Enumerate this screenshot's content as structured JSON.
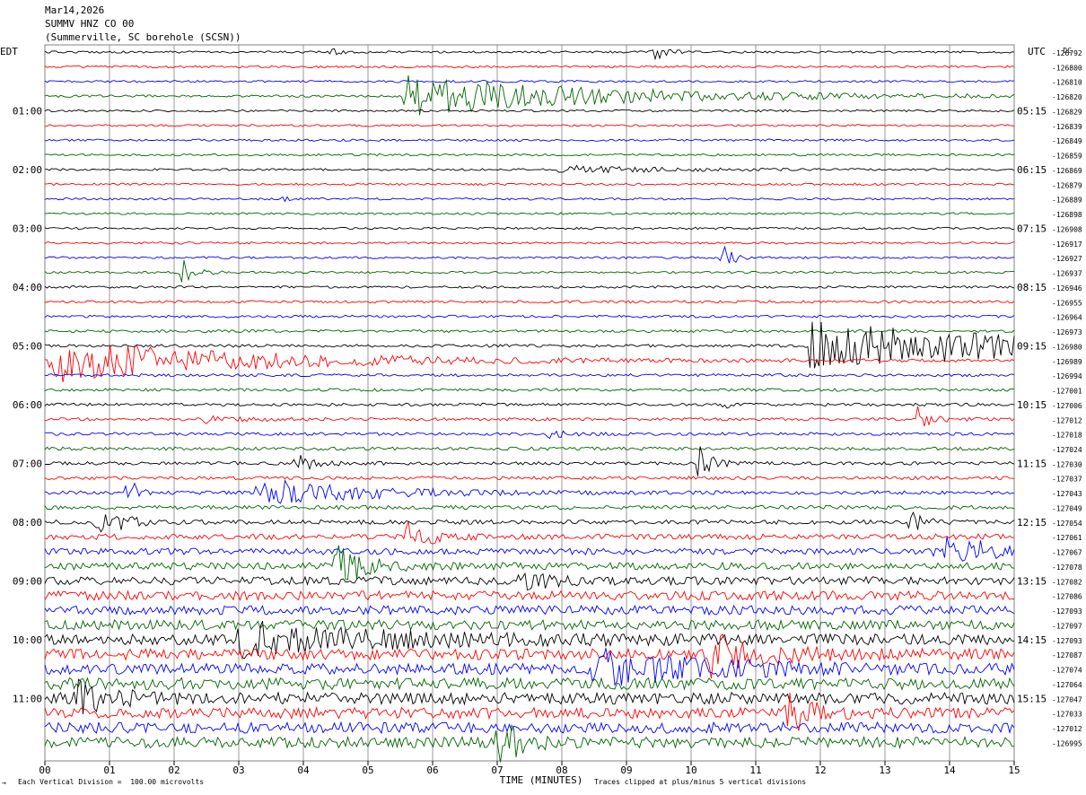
{
  "header": {
    "date": "Mar14,2026",
    "station": "SUMMV HNZ CO 00",
    "location": "(Summerville, SC borehole (SCSN))"
  },
  "labels": {
    "left_tz": "EDT",
    "right_tz": "UTC",
    "dc": "DC",
    "xlabel": "TIME (MINUTES)",
    "scale_note": "Each Vertical Division =  100.00 microvolts",
    "clip_note": "Traces clipped at plus/minus 5 vertical divisions",
    "corner_mark": "→"
  },
  "colors": {
    "trace_cycle": [
      "#000000",
      "#ff0000",
      "#0000ff",
      "#006400"
    ],
    "grid": "#808080",
    "background": "#ffffff"
  },
  "chart_data": {
    "type": "line",
    "title": "SUMMV HNZ CO 00",
    "xlabel": "TIME (MINUTES)",
    "xlim": [
      0,
      15
    ],
    "x_ticks": [
      "00",
      "01",
      "02",
      "03",
      "04",
      "05",
      "06",
      "07",
      "08",
      "09",
      "10",
      "11",
      "12",
      "13",
      "14",
      "15"
    ],
    "rows_per_hour": 4,
    "row_minutes": 15,
    "trace_count": 48,
    "left_hour_labels": [
      "EDT",
      "01:00",
      "02:00",
      "03:00",
      "04:00",
      "05:00",
      "06:00",
      "07:00",
      "08:00",
      "09:00",
      "10:00",
      "11:00"
    ],
    "right_hour_labels": [
      "UTC",
      "05:15",
      "06:15",
      "07:15",
      "08:15",
      "09:15",
      "10:15",
      "11:15",
      "12:15",
      "13:15",
      "14:15",
      "15:15"
    ],
    "dc_offsets": [
      -126792,
      -126800,
      -126810,
      -126820,
      -126829,
      -126839,
      -126849,
      -126859,
      -126869,
      -126879,
      -126889,
      -126898,
      -126908,
      -126917,
      -126927,
      -126937,
      -126946,
      -126955,
      -126964,
      -126973,
      -126980,
      -126989,
      -126994,
      -127001,
      -127006,
      -127012,
      -127018,
      -127024,
      -127030,
      -127037,
      -127043,
      -127049,
      -127054,
      -127061,
      -127067,
      -127078,
      -127082,
      -127086,
      -127093,
      -127097,
      -127093,
      -127087,
      -127074,
      -127064,
      -127047,
      -127033,
      -127012,
      -126995
    ],
    "noise_level": [
      1.2,
      1.3,
      1.2,
      1.3,
      1.2,
      1.2,
      1.2,
      1.2,
      1.2,
      1.2,
      1.2,
      1.2,
      1.2,
      1.2,
      1.2,
      1.2,
      1.3,
      1.4,
      1.4,
      1.5,
      1.6,
      1.5,
      1.6,
      1.6,
      1.6,
      1.7,
      1.7,
      1.8,
      1.8,
      1.9,
      2.0,
      2.2,
      2.4,
      3.0,
      3.5,
      4.0,
      4.5,
      5.0,
      5.0,
      5.5,
      6.0,
      6.0,
      6.0,
      6.5,
      6.5,
      6.0,
      6.0,
      6.0
    ],
    "events": [
      {
        "trace": 0,
        "minute": 9.4,
        "duration": 0.15,
        "amplitude": 20
      },
      {
        "trace": 0,
        "minute": 4.4,
        "duration": 0.2,
        "amplitude": 4
      },
      {
        "trace": 3,
        "minute": 5.6,
        "duration": 3.0,
        "amplitude": 22
      },
      {
        "trace": 8,
        "minute": 8.0,
        "duration": 1.2,
        "amplitude": 5
      },
      {
        "trace": 10,
        "minute": 3.7,
        "duration": 0.1,
        "amplitude": 4
      },
      {
        "trace": 14,
        "minute": 10.5,
        "duration": 0.15,
        "amplitude": 15
      },
      {
        "trace": 15,
        "minute": 2.1,
        "duration": 0.2,
        "amplitude": 16
      },
      {
        "trace": 20,
        "minute": 11.8,
        "duration": 3.5,
        "amplitude": 30
      },
      {
        "trace": 21,
        "minute": 0.1,
        "duration": 3.0,
        "amplitude": 24
      },
      {
        "trace": 24,
        "minute": 10.5,
        "duration": 0.15,
        "amplitude": 5
      },
      {
        "trace": 25,
        "minute": 13.5,
        "duration": 0.2,
        "amplitude": 14
      },
      {
        "trace": 25,
        "minute": 2.5,
        "duration": 0.5,
        "amplitude": 4
      },
      {
        "trace": 26,
        "minute": 7.8,
        "duration": 0.3,
        "amplitude": 4
      },
      {
        "trace": 28,
        "minute": 10.1,
        "duration": 0.2,
        "amplitude": 22
      },
      {
        "trace": 28,
        "minute": 3.9,
        "duration": 0.3,
        "amplitude": 9
      },
      {
        "trace": 30,
        "minute": 3.3,
        "duration": 1.5,
        "amplitude": 16
      },
      {
        "trace": 30,
        "minute": 1.3,
        "duration": 0.1,
        "amplitude": 22
      },
      {
        "trace": 32,
        "minute": 0.8,
        "duration": 0.3,
        "amplitude": 24
      },
      {
        "trace": 32,
        "minute": 13.4,
        "duration": 0.15,
        "amplitude": 16
      },
      {
        "trace": 33,
        "minute": 5.6,
        "duration": 0.3,
        "amplitude": 20
      },
      {
        "trace": 34,
        "minute": 13.8,
        "duration": 1.2,
        "amplitude": 16
      },
      {
        "trace": 35,
        "minute": 4.5,
        "duration": 0.4,
        "amplitude": 24
      },
      {
        "trace": 36,
        "minute": 7.3,
        "duration": 0.5,
        "amplitude": 10
      },
      {
        "trace": 40,
        "minute": 3.0,
        "duration": 2.0,
        "amplitude": 18
      },
      {
        "trace": 41,
        "minute": 10.3,
        "duration": 0.8,
        "amplitude": 22
      },
      {
        "trace": 42,
        "minute": 8.5,
        "duration": 1.5,
        "amplitude": 20
      },
      {
        "trace": 44,
        "minute": 0.5,
        "duration": 0.5,
        "amplitude": 16
      },
      {
        "trace": 45,
        "minute": 11.5,
        "duration": 0.3,
        "amplitude": 26
      },
      {
        "trace": 47,
        "minute": 7.0,
        "duration": 0.3,
        "amplitude": 28
      }
    ]
  }
}
